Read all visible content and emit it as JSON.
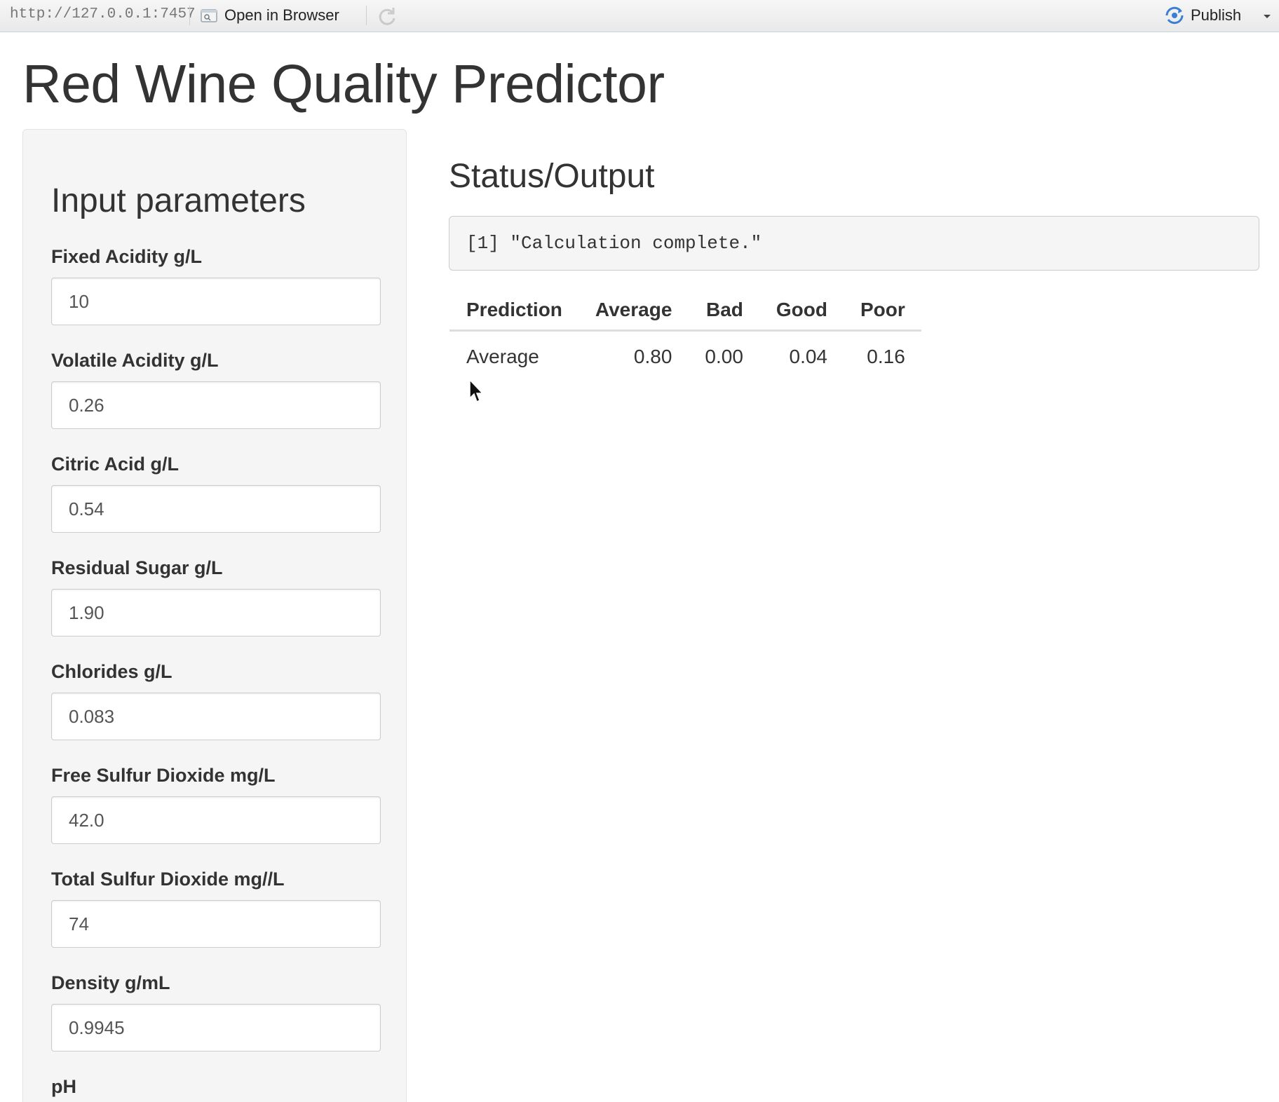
{
  "toolbar": {
    "url": "http://127.0.0.1:7457",
    "open_in_browser_label": "Open in Browser",
    "publish_label": "Publish",
    "accent_color": "#3a7fd5"
  },
  "page": {
    "title": "Red Wine Quality Predictor"
  },
  "sidebar": {
    "title": "Input parameters",
    "fields": [
      {
        "label": "Fixed Acidity g/L",
        "value": "10"
      },
      {
        "label": "Volatile Acidity g/L",
        "value": "0.26"
      },
      {
        "label": "Citric Acid g/L",
        "value": "0.54"
      },
      {
        "label": "Residual Sugar g/L",
        "value": "1.90"
      },
      {
        "label": "Chlorides g/L",
        "value": "0.083"
      },
      {
        "label": "Free Sulfur Dioxide mg/L",
        "value": "42.0"
      },
      {
        "label": "Total Sulfur Dioxide mg//L",
        "value": "74"
      },
      {
        "label": "Density g/mL",
        "value": "0.9945"
      },
      {
        "label": "pH",
        "value": ""
      }
    ]
  },
  "main": {
    "title": "Status/Output",
    "status_text": "[1] \"Calculation complete.\"",
    "table": {
      "headers": [
        "Prediction",
        "Average",
        "Bad",
        "Good",
        "Poor"
      ],
      "rows": [
        [
          "Average",
          "0.80",
          "0.00",
          "0.04",
          "0.16"
        ]
      ]
    }
  }
}
